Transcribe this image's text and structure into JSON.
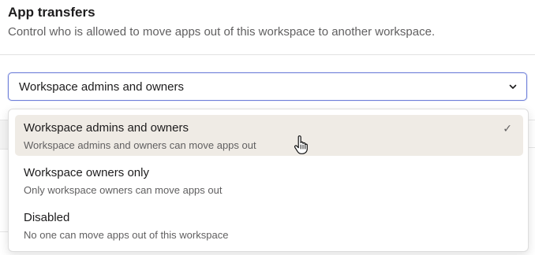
{
  "section": {
    "title": "App transfers",
    "description": "Control who is allowed to move apps out of this workspace to another workspace."
  },
  "select": {
    "value": "Workspace admins and owners",
    "icon": "chevron-down-icon"
  },
  "dropdown": {
    "options": [
      {
        "label": "Workspace admins and owners",
        "description": "Workspace admins and owners can move apps out",
        "selected": true
      },
      {
        "label": "Workspace owners only",
        "description": "Only workspace owners can move apps out",
        "selected": false
      },
      {
        "label": "Disabled",
        "description": "No one can move apps out of this workspace",
        "selected": false
      }
    ],
    "check_glyph": "✓"
  },
  "colors": {
    "accent_border": "#6e7fd9",
    "selected_bg": "#efebe5",
    "muted_text": "#616061"
  }
}
